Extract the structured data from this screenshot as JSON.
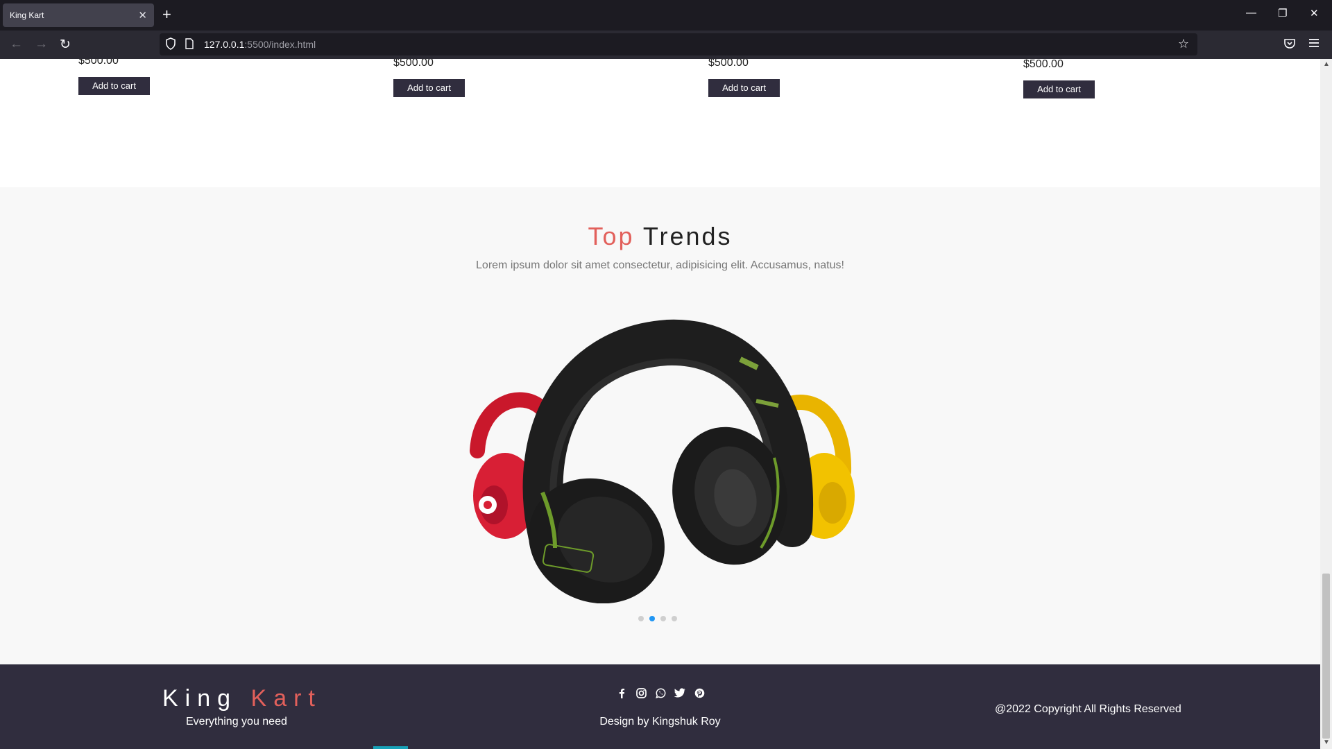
{
  "browser": {
    "tab_title": "King Kart",
    "tab_close_icon": "close-icon",
    "new_tab_icon": "plus-icon",
    "url_host": "127.0.0.1",
    "url_rest": ":5500/index.html"
  },
  "products": [
    {
      "price": "$500.00",
      "button": "Add to cart"
    },
    {
      "price": "$500.00",
      "button": "Add to cart"
    },
    {
      "price": "$500.00",
      "button": "Add to cart"
    },
    {
      "price": "$500.00",
      "button": "Add to cart"
    }
  ],
  "trends": {
    "title_accent": "Top",
    "title_rest": "Trends",
    "subtitle": "Lorem ipsum dolor sit amet consectetur, adipisicing elit. Accusamus, natus!",
    "carousel_dots": 4,
    "active_dot": 1
  },
  "footer": {
    "brand_first": "King",
    "brand_accent": "Kart",
    "tagline": "Everything you need",
    "socials": [
      "facebook-icon",
      "instagram-icon",
      "whatsapp-icon",
      "twitter-icon",
      "pinterest-icon"
    ],
    "designer": "Design by Kingshuk Roy",
    "copyright": "@2022 Copyright All Rights Reserved"
  },
  "colors": {
    "accent": "#e2605b",
    "dark": "#302d3e",
    "dot_active": "#2196f3"
  }
}
